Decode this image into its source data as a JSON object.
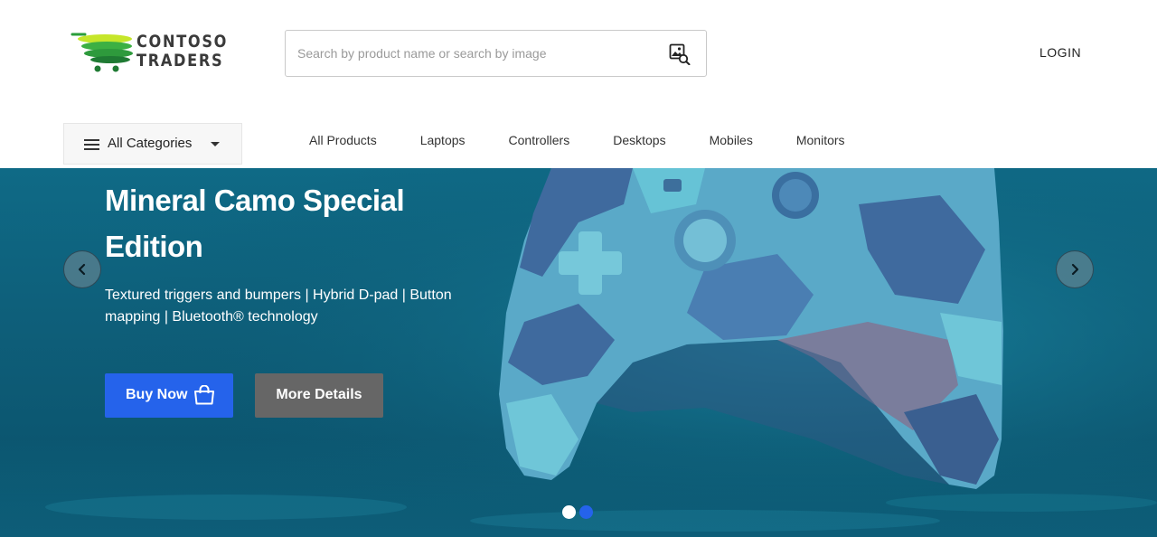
{
  "brand": {
    "line1": "CONTOSO",
    "line2": "TRADERS"
  },
  "search": {
    "placeholder": "Search by product name or search by image",
    "value": "",
    "icon": "image-search-icon"
  },
  "header": {
    "login_label": "LOGIN"
  },
  "categories": {
    "label": "All Categories",
    "icon": "menu-icon"
  },
  "nav": {
    "items": [
      "All Products",
      "Laptops",
      "Controllers",
      "Desktops",
      "Mobiles",
      "Monitors"
    ]
  },
  "hero": {
    "title": "Mineral Camo Special Edition",
    "description": "Textured triggers and bumpers | Hybrid D-pad | Button mapping | Bluetooth® technology",
    "buy_label": "Buy Now",
    "more_label": "More Details",
    "slide_count": 2,
    "active_slide": 1
  },
  "colors": {
    "primary_button": "#2563eb",
    "secondary_button": "#666666",
    "dot_active": "#ffffff",
    "dot_inactive": "#2563eb"
  }
}
